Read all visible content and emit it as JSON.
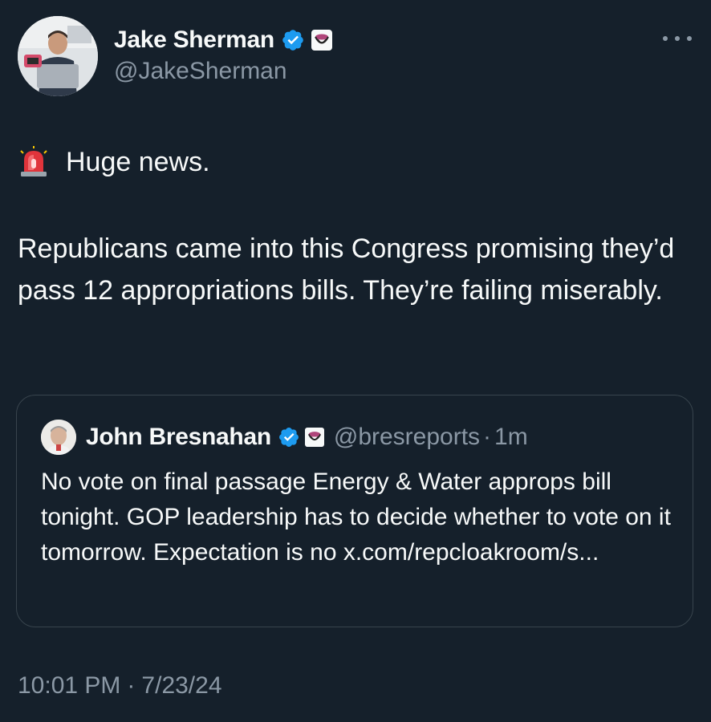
{
  "author": {
    "name": "Jake Sherman",
    "handle": "@JakeSherman",
    "verified_color": "#1d9bf0"
  },
  "tweet": {
    "first_line": "Huge news.",
    "first_line_icon": "police-siren-emoji",
    "paragraph": "Republicans came into this Congress promising they’d pass 12 appropriations bills. They’re failing miserably."
  },
  "quoted": {
    "name": "John Bresnahan",
    "handle": "@bresreports",
    "separator": "·",
    "time": "1m",
    "text": "No vote on final passage Energy & Water approps bill tonight. GOP leadership has to decide whether to vote on it tomorrow. Expectation is no x.com/repcloakroom/s..."
  },
  "footer": {
    "time": "10:01 PM",
    "separator": "·",
    "date": "7/23/24"
  },
  "colors": {
    "background": "#15202b",
    "text_primary": "#f7f9f9",
    "text_secondary": "#8b98a5",
    "border": "#38444d"
  }
}
